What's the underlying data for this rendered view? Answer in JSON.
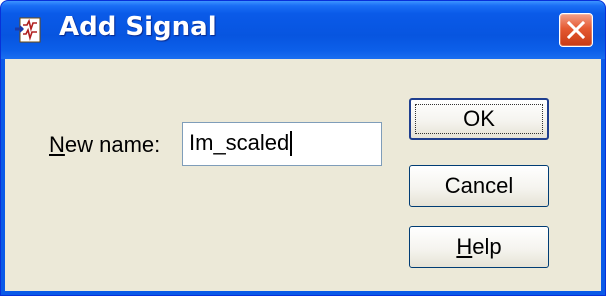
{
  "dialog": {
    "title": "Add Signal",
    "app_icon": "signal-editor-icon",
    "close_icon": "close-icon",
    "colors": {
      "titlebar": "#0a5ae8",
      "client": "#ece9d8",
      "close": "#e55a32"
    }
  },
  "form": {
    "label_mnemonic": "N",
    "label_rest": "ew name:",
    "value": "Im_scaled"
  },
  "buttons": {
    "ok": "OK",
    "cancel": "Cancel",
    "help_mnemonic": "H",
    "help_rest": "elp"
  }
}
